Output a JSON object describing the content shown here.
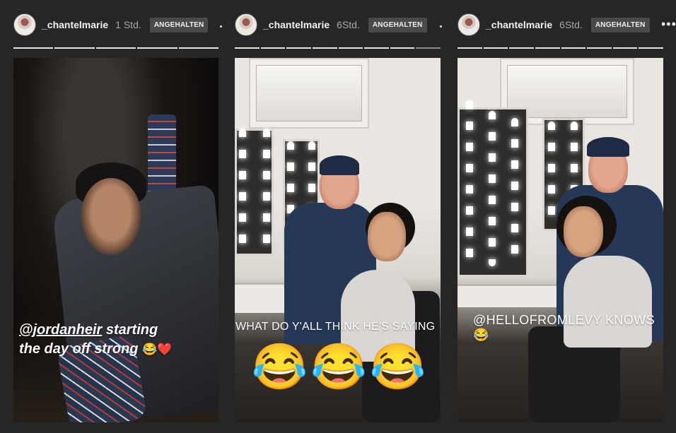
{
  "stories": [
    {
      "username": "_chantelmarie",
      "timestamp": "1 Std.",
      "badge": "ANGEHALTEN",
      "progress_segments": 5,
      "caption_mention": "@jordanheir",
      "caption_line1_rest": " starting",
      "caption_line2": "the day off strong",
      "caption_emojis": "😂❤️"
    },
    {
      "username": "_chantelmarie",
      "timestamp": "6Std.",
      "badge": "ANGEHALTEN",
      "progress_segments": 8,
      "caption": "WHAT DO Y'ALL THINK HE'S SAYING",
      "emojis": [
        "😂",
        "😂",
        "😂"
      ]
    },
    {
      "username": "_chantelmarie",
      "timestamp": "6Std.",
      "badge": "ANGEHALTEN",
      "progress_segments": 8,
      "caption": "@HELLOFROMLEVY KNOWS😂"
    }
  ],
  "more_label": "•••",
  "colors": {
    "background": "#262626",
    "progress_active": "#e6e6e6",
    "badge_bg": "#4a4a4a"
  },
  "icons": [
    "avatar",
    "more-options-icon",
    "dot-separator-icon"
  ]
}
